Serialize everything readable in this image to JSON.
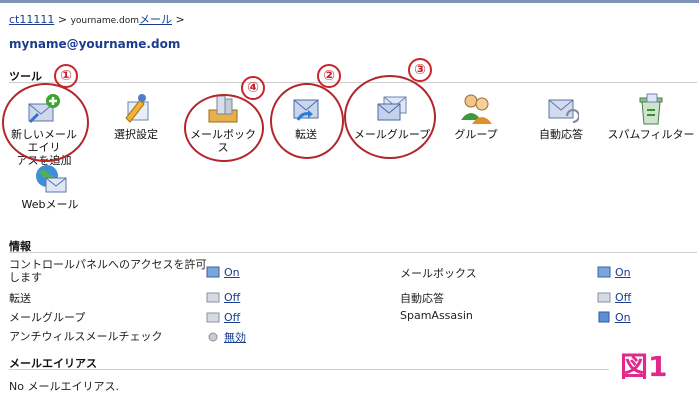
{
  "breadcrumb": {
    "account": "ct11111",
    "sep": ">",
    "domain": "yourname.dom",
    "mail": "メール",
    "sep2": ">"
  },
  "account_title": "myname@yourname.dom",
  "tools_section": "ツール",
  "tools": [
    {
      "id": "new-alias",
      "label": "新しいメールエイリアスを追加",
      "line1": "新しいメールエイリ",
      "line2": "アスを追加",
      "icon": "mail-add-icon"
    },
    {
      "id": "prefs",
      "label": "選択設定",
      "icon": "preferences-icon"
    },
    {
      "id": "mailbox",
      "label": "メールボックス",
      "icon": "mailbox-icon"
    },
    {
      "id": "forward",
      "label": "転送",
      "icon": "forward-icon"
    },
    {
      "id": "mailgroup",
      "label": "メールグループ",
      "icon": "mailgroup-icon"
    },
    {
      "id": "group",
      "label": "グループ",
      "icon": "users-icon"
    },
    {
      "id": "autoreply",
      "label": "自動応答",
      "icon": "autoreply-icon"
    },
    {
      "id": "spamfilter",
      "label": "スパムフィルター",
      "icon": "spamfilter-icon"
    },
    {
      "id": "webmail",
      "label": "Webメール",
      "icon": "webmail-icon"
    }
  ],
  "markers": [
    "①",
    "④",
    "②",
    "③"
  ],
  "info_section": "情報",
  "info_left": [
    {
      "label": "コントロールパネルへのアクセスを許可します",
      "state": "On",
      "icon": "control-panel-icon"
    },
    {
      "label": "転送",
      "state": "Off",
      "icon": "forward-small-icon"
    },
    {
      "label": "メールグループ",
      "state": "Off",
      "icon": "mailgroup-small-icon"
    },
    {
      "label": "アンチウィルスメールチェック",
      "state": "無効",
      "icon": "antivirus-icon"
    }
  ],
  "info_right": [
    {
      "label": "メールボックス",
      "state": "On",
      "icon": "mailbox-small-icon"
    },
    {
      "label": "自動応答",
      "state": "Off",
      "icon": "autoreply-small-icon"
    },
    {
      "label": "SpamAssasin",
      "state": "On",
      "icon": "spamassassin-icon"
    }
  ],
  "alias_section": "メールエイリアス",
  "alias_text": "No メールエイリアス.",
  "figure_label": "図1",
  "colors": {
    "link": "#1a3d8f",
    "annotation": "#b3262e",
    "figure": "#e0298a"
  }
}
